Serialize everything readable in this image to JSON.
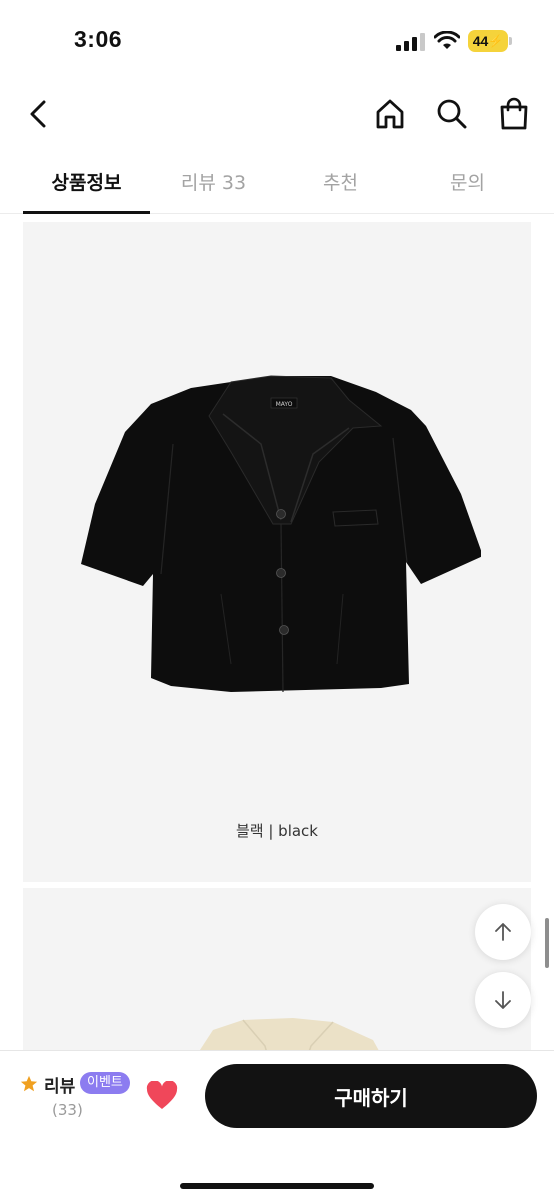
{
  "status": {
    "time": "3:06",
    "battery": "44"
  },
  "tabs": [
    {
      "label": "상품정보",
      "active": true
    },
    {
      "label": "리뷰 33",
      "active": false
    },
    {
      "label": "추천",
      "active": false
    },
    {
      "label": "문의",
      "active": false
    }
  ],
  "product": {
    "brand_tag": "MAYO",
    "caption": "블랙 | black"
  },
  "bottom_bar": {
    "review_label": "리뷰",
    "event_badge": "이벤트",
    "review_count": "(33)",
    "buy_label": "구매하기"
  },
  "colors": {
    "accent_event": "#8c7cf0",
    "heart": "#f0475a",
    "star": "#f0a020",
    "buy_button": "#121212",
    "battery": "#f5d33b"
  },
  "icons": [
    "back-icon",
    "home-icon",
    "search-icon",
    "shopping-bag-icon",
    "arrow-up-icon",
    "arrow-down-icon",
    "star-icon",
    "heart-icon"
  ]
}
